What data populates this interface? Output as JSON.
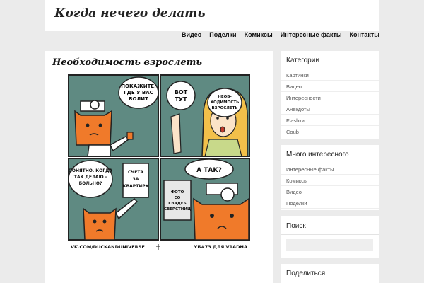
{
  "site": {
    "title": "Когда нечего делать"
  },
  "nav": {
    "items": [
      "Видео",
      "Поделки",
      "Комиксы",
      "Интересные факты",
      "Контакты"
    ]
  },
  "post": {
    "title": "Необходимость взрослеть"
  },
  "comic": {
    "panel1_text": "ПОКАЖИТЕ, ГДЕ У ВАС БОЛИТ",
    "panel2_text_left": "ВОТ ТУТ",
    "panel2_text_right": "НЕОБ-ХОДИМОСТЬ ВЗРОСЛЕТЬ",
    "panel3_text_left": "ПОНЯТНО. КОГДА ТАК ДЕЛАЮ - БОЛЬНО?",
    "panel3_text_right": "СЧЕТА ЗА КВАРТИРУ",
    "panel4_text": "А ТАК?",
    "panel4_book": "ФОТО СО СВАДЕБ СВЕРСТНИЦ",
    "footer_left": "VK.COM/DUCKANDUNIVERSE",
    "footer_right": "УБ#73 ДЛЯ V1ADHA",
    "colors": {
      "bg": "#5f8a82",
      "fox": "#f07a2a",
      "panel_border": "#222222",
      "girl_hair": "#f2c04a"
    }
  },
  "sidebar": {
    "categories": {
      "title": "Категории",
      "items": [
        "Картинки",
        "Видео",
        "Интересности",
        "Анекдоты",
        "Flashки",
        "Coub"
      ]
    },
    "interesting": {
      "title": "Много интересного",
      "items": [
        "Интересные факты",
        "Комиксы",
        "Видео",
        "Поделки"
      ]
    },
    "search": {
      "title": "Поиск",
      "placeholder": ""
    },
    "share": {
      "title": "Поделиться"
    }
  }
}
